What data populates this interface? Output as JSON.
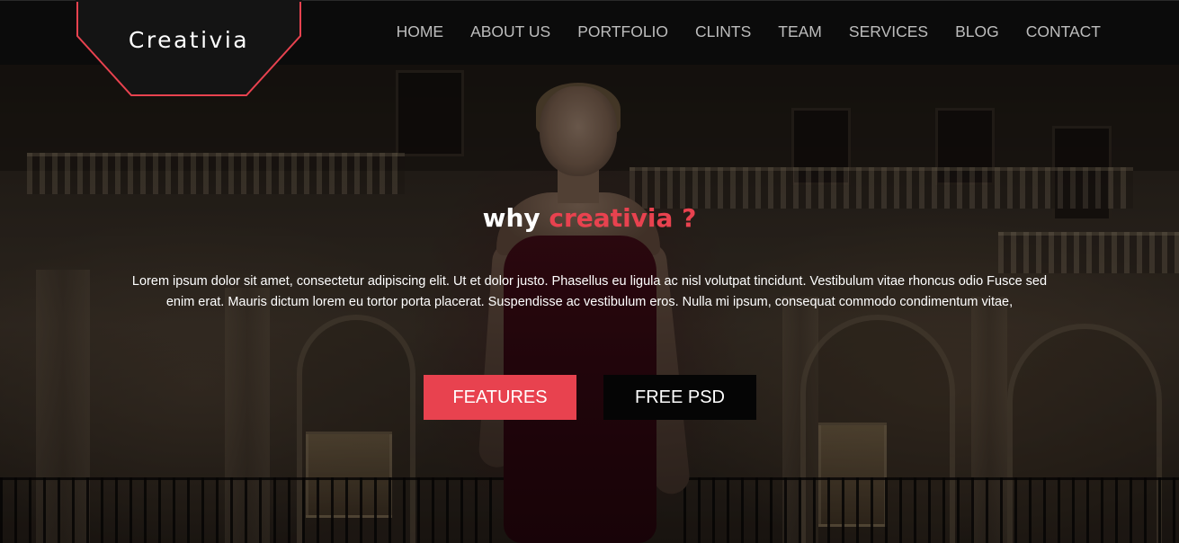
{
  "brand": {
    "logo_text": "Creativia",
    "accent_color": "#e8424f"
  },
  "nav": {
    "items": [
      {
        "label": "HOME"
      },
      {
        "label": "ABOUT US"
      },
      {
        "label": "PORTFOLIO"
      },
      {
        "label": "CLINTS"
      },
      {
        "label": "TEAM"
      },
      {
        "label": "SERVICES"
      },
      {
        "label": "BLOG"
      },
      {
        "label": "CONTACT"
      }
    ]
  },
  "hero": {
    "headline_prefix": "why",
    "headline_accent": "creativia ?",
    "lead_text": "Lorem ipsum dolor sit amet, consectetur adipiscing elit. Ut et dolor justo. Phasellus eu ligula ac nisl volutpat tincidunt. Vestibulum vitae rhoncus odio Fusce sed enim erat. Mauris dictum lorem eu tortor porta placerat. Suspendisse ac vestibulum eros. Nulla mi ipsum, consequat commodo condimentum vitae,",
    "buttons": {
      "features_label": "FEATURES",
      "free_psd_label": "FREE PSD"
    }
  }
}
